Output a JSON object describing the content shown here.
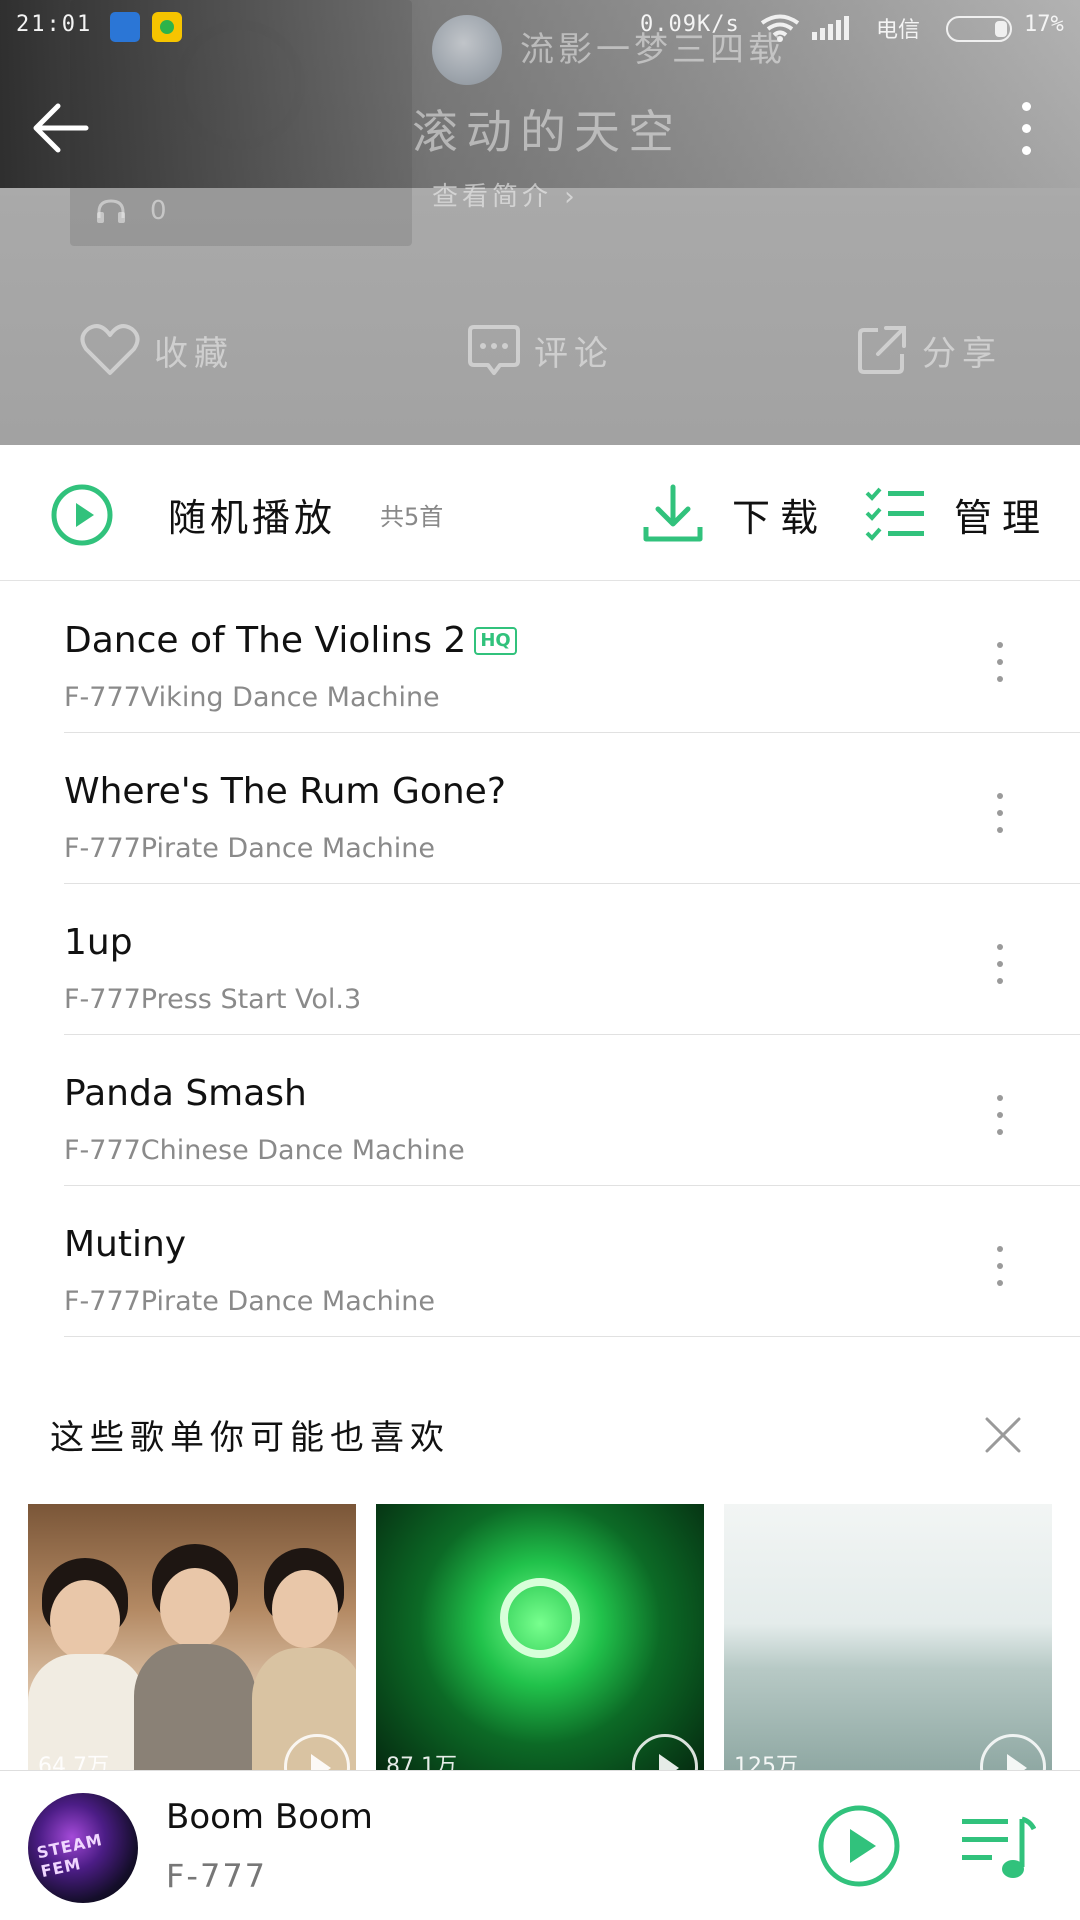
{
  "status_bar": {
    "time": "21:01",
    "network_speed": "0.09K/s",
    "carrier": "电信",
    "battery": "17%"
  },
  "header": {
    "creator_name": "流影一梦三四载",
    "title": "滚动的天空",
    "intro_link": "查看简介",
    "listen_count": "0",
    "actions": {
      "favorite": "收藏",
      "comment": "评论",
      "share": "分享"
    }
  },
  "toolbar": {
    "shuffle_label": "随机播放",
    "song_count": "共5首",
    "download_label": "下载",
    "manage_label": "管理"
  },
  "songs": [
    {
      "title": "Dance of The Violins 2",
      "hq": "HQ",
      "subtitle": "F-777Viking Dance Machine"
    },
    {
      "title": "Where's The Rum Gone?",
      "subtitle": "F-777Pirate Dance Machine"
    },
    {
      "title": "1up",
      "subtitle": "F-777Press Start Vol.3"
    },
    {
      "title": "Panda Smash",
      "subtitle": "F-777Chinese Dance Machine"
    },
    {
      "title": "Mutiny",
      "subtitle": "F-777Pirate Dance Machine"
    }
  ],
  "recommendations": {
    "title": "这些歌单你可能也喜欢",
    "cards": [
      {
        "meta": "64.7万"
      },
      {
        "meta": "87.1万"
      },
      {
        "meta": "125万"
      }
    ]
  },
  "now_playing": {
    "title": "Boom Boom",
    "artist": "F-777",
    "art_text": "STEAM FEM"
  },
  "colors": {
    "accent": "#31c27c",
    "header_bg": "#a8a8a8"
  }
}
